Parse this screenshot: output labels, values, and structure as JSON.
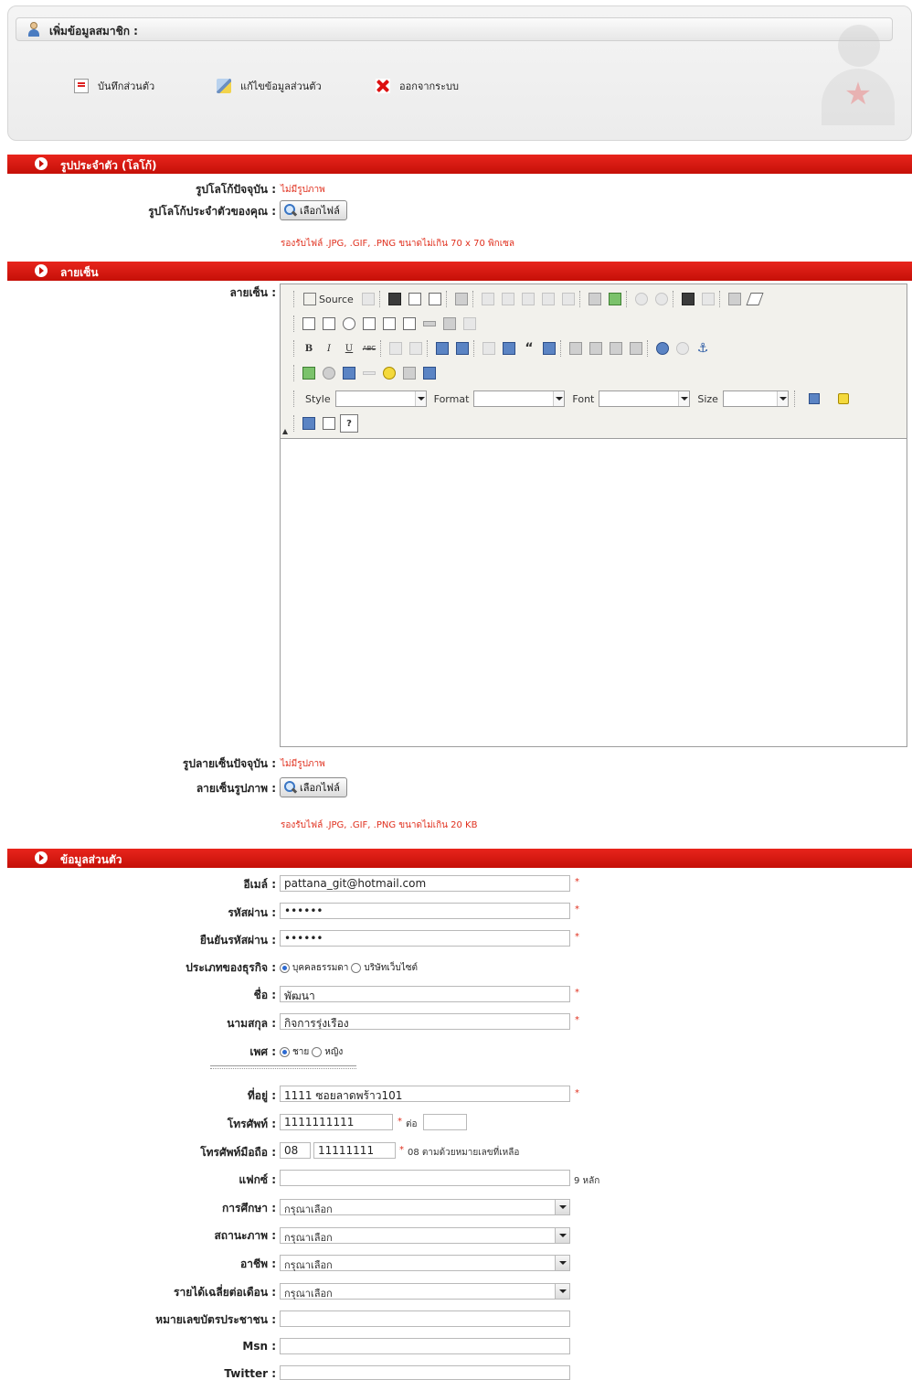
{
  "header": {
    "title": "เพิ่มข้อมูลสมาชิก :",
    "actions": [
      "บันทึกส่วนตัว",
      "แก้ไขข้อมูลส่วนตัว",
      "ออกจากระบบ"
    ]
  },
  "logo_section": {
    "title": "รูปประจำตัว (โลโก้)",
    "current_label": "รูปโลโก้ปัจจุบัน :",
    "current_value": "ไม่มีรูปภาพ",
    "upload_label": "รูปโลโก้ประจำตัวของคุณ :",
    "upload_button": "เลือกไฟล์",
    "note": "รองรับไฟล์ .JPG, .GIF, .PNG ขนาดไม่เกิน 70 x 70 พิกเซล"
  },
  "signature_section": {
    "title": "ลายเซ็น",
    "editor_label": "ลายเซ็น :",
    "toolbar": {
      "source": "Source",
      "style_label": "Style",
      "format_label": "Format",
      "font_label": "Font",
      "size_label": "Size"
    },
    "current_label": "รูปลายเซ็นปัจจุบัน :",
    "current_value": "ไม่มีรูปภาพ",
    "upload_label": "ลายเซ็นรูปภาพ :",
    "upload_button": "เลือกไฟล์",
    "note": "รองรับไฟล์ .JPG, .GIF, .PNG ขนาดไม่เกิน 20 KB"
  },
  "personal_section": {
    "title": "ข้อมูลส่วนตัว",
    "email": {
      "label": "อีเมล์ :",
      "value": "pattana_git@hotmail.com"
    },
    "password": {
      "label": "รหัสผ่าน :",
      "value": "••••••"
    },
    "confirm_password": {
      "label": "ยืนยันรหัสผ่าน :",
      "value": "••••••"
    },
    "business_type": {
      "label": "ประเภทของธุรกิจ :",
      "options": [
        "บุคคลธรรมดา",
        "บริษัทเว็บไซต์"
      ],
      "selected": "บุคคลธรรมดา"
    },
    "first_name": {
      "label": "ชื่อ :",
      "value": "พัฒนา"
    },
    "last_name": {
      "label": "นามสกุล :",
      "value": "กิจการรุ่งเรือง"
    },
    "gender": {
      "label": "เพศ :",
      "options": [
        "ชาย",
        "หญิง"
      ],
      "selected": "ชาย"
    },
    "address": {
      "label": "ที่อยู่ :",
      "value": "1111 ซอยลาดพร้าว101"
    },
    "phone": {
      "label": "โทรศัพท์ :",
      "value": "1111111111",
      "ext_label": "ต่อ",
      "ext_value": ""
    },
    "mobile": {
      "label": "โทรศัพท์มือถือ :",
      "prefix": "08",
      "value": "11111111",
      "hint": "08 ตามด้วยหมายเลขที่เหลือ"
    },
    "fax": {
      "label": "แฟกซ์ :",
      "value": "",
      "hint": "9 หลัก"
    },
    "education": {
      "label": "การศึกษา :",
      "value": "กรุณาเลือก"
    },
    "marital": {
      "label": "สถานะภาพ :",
      "value": "กรุณาเลือก"
    },
    "occupation": {
      "label": "อาชีพ :",
      "value": "กรุณาเลือก"
    },
    "income": {
      "label": "รายได้เฉลี่ยต่อเดือน :",
      "value": "กรุณาเลือก"
    },
    "id_card": {
      "label": "หมายเลขบัตรประชาชน :",
      "value": ""
    },
    "msn": {
      "label": "Msn :",
      "value": ""
    },
    "twitter": {
      "label": "Twitter :",
      "value": ""
    }
  },
  "colors": {
    "section_bar": "#d41a12",
    "required": "#e0301e",
    "note": "#e0301e"
  }
}
